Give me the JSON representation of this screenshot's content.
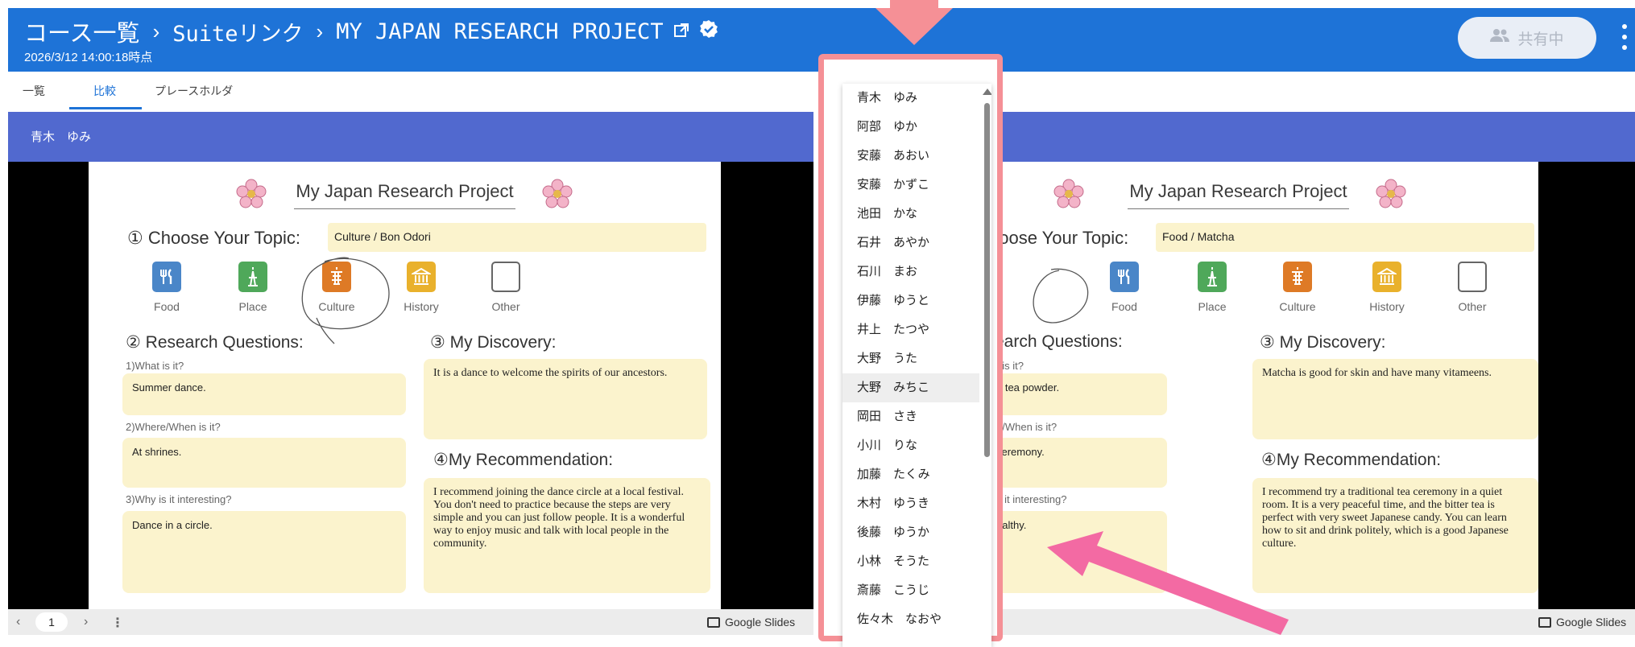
{
  "header": {
    "breadcrumb": [
      "コース一覧",
      "Suiteリンク",
      "MY JAPAN RESEARCH PROJECT"
    ],
    "separator": "›",
    "datetime": "2026/3/12 14:00:18時点",
    "share_label": "共有中"
  },
  "tabs": [
    "一覧",
    "比較",
    "プレースホルダ"
  ],
  "active_tab": "比較",
  "left_panel": {
    "student": "青木　ゆみ",
    "slide": {
      "title": "My Japan Research Project",
      "topic_label": "① Choose Your Topic:",
      "topic_value": "Culture / Bon Odori",
      "icons": [
        "Food",
        "Place",
        "Culture",
        "History",
        "Other"
      ],
      "circled_icon": "Culture",
      "rq_heading": "② Research Questions:",
      "q1": "1)What is it?",
      "a1": "Summer dance.",
      "q2": "2)Where/When is it?",
      "a2": "At shrines.",
      "q3": "3)Why is it interesting?",
      "a3": "Dance in a circle.",
      "discovery_heading": "③ My Discovery:",
      "discovery": "It is a dance to welcome the spirits of our ancestors.",
      "rec_heading": "④My Recommendation:",
      "recommendation": "I recommend joining the dance circle at a local festival. You don't need to practice because the steps are very simple and you can just follow people. It is a wonderful way to enjoy music and talk with local people in the community."
    },
    "page": "1",
    "footer_brand": "Google Slides"
  },
  "right_panel": {
    "slide": {
      "title": "My Japan Research Project",
      "topic_label": "hoose Your Topic:",
      "topic_value": "Food / Matcha",
      "icons": [
        "Food",
        "Place",
        "Culture",
        "History",
        "Other"
      ],
      "circled_icon": "Food",
      "rq_heading": "earch Questions:",
      "q1": "t is it?",
      "a1": "n tea powder.",
      "q2": "e/When is it?",
      "a2": "ceremony.",
      "q3": "s it interesting?",
      "a3": "ealthy.",
      "discovery_heading": "③ My Discovery:",
      "discovery": "Matcha is good for skin and have many vitameens.",
      "rec_heading": "④My Recommendation:",
      "recommendation": "I recommend try a traditional tea ceremony in a quiet room. It is a very peaceful time, and the bitter tea is perfect with very sweet Japanese candy. You can learn how to sit and drink politely, which is a good Japanese culture."
    },
    "footer_brand": "Google Slides"
  },
  "student_dropdown": {
    "items": [
      "青木　ゆみ",
      "阿部　ゆか",
      "安藤　あおい",
      "安藤　かずこ",
      "池田　かな",
      "石井　あやか",
      "石川　まお",
      "伊藤　ゆうと",
      "井上　たつや",
      "大野　うた",
      "大野　みちこ",
      "岡田　さき",
      "小川　りな",
      "加藤　たくみ",
      "木村　ゆうき",
      "後藤　ゆうか",
      "小林　そうた",
      "斎藤　こうじ",
      "佐々木　なおや"
    ],
    "highlighted": "大野　みちこ"
  },
  "colors": {
    "header_blue": "#1e73d7",
    "band_blue": "#5169cf",
    "answer_box": "#fbf3cd",
    "annotation_pink": "#f59096",
    "arrow_pink": "#f36aa3"
  }
}
